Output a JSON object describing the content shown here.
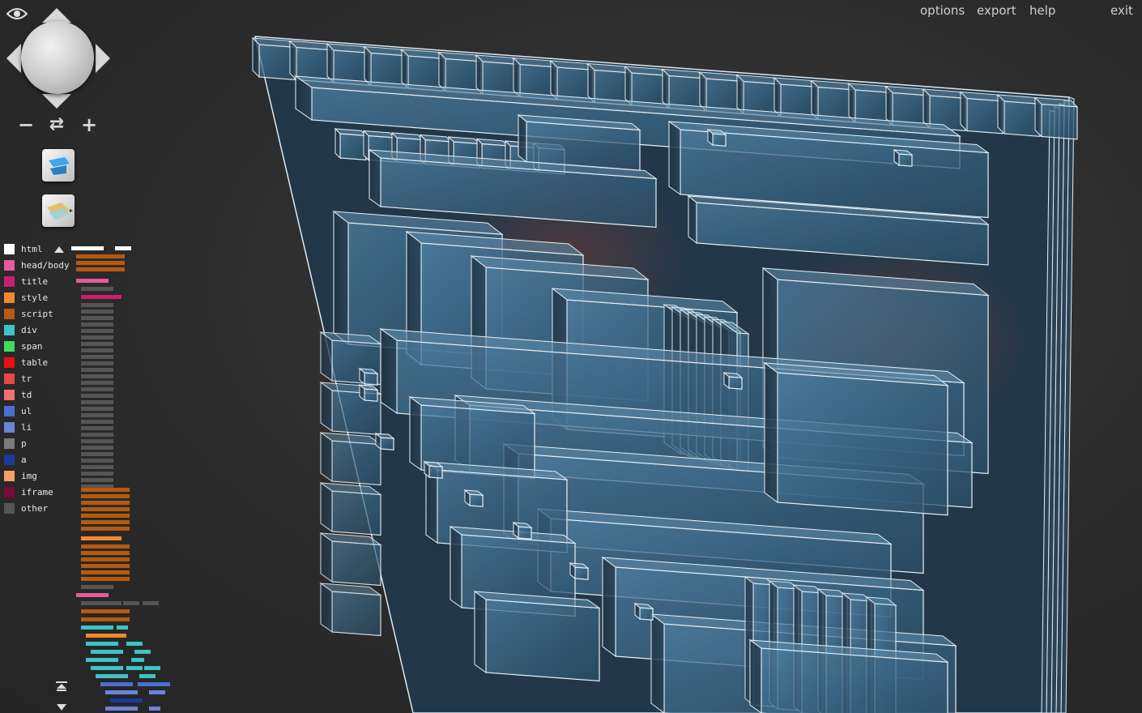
{
  "menu": {
    "options": "options",
    "export": "export",
    "help": "help",
    "exit": "exit"
  },
  "controls": {
    "zoom_out": "−",
    "reset": "⇄",
    "zoom_in": "+"
  },
  "legend": [
    {
      "label": "html",
      "color": "#ffffff"
    },
    {
      "label": "head/body",
      "color": "#e85a9b"
    },
    {
      "label": "title",
      "color": "#cc1f6e"
    },
    {
      "label": "style",
      "color": "#f08a2c"
    },
    {
      "label": "script",
      "color": "#b55a10"
    },
    {
      "label": "div",
      "color": "#3ec4c4"
    },
    {
      "label": "span",
      "color": "#3ddc5c"
    },
    {
      "label": "table",
      "color": "#e81010"
    },
    {
      "label": "tr",
      "color": "#e84848"
    },
    {
      "label": "td",
      "color": "#f07070"
    },
    {
      "label": "ul",
      "color": "#4a6fd0"
    },
    {
      "label": "li",
      "color": "#6a85d8"
    },
    {
      "label": "p",
      "color": "#7a7a7a"
    },
    {
      "label": "a",
      "color": "#1a3aa0"
    },
    {
      "label": "img",
      "color": "#f4a060"
    },
    {
      "label": "iframe",
      "color": "#7a0a3a"
    },
    {
      "label": "other",
      "color": "#555555"
    }
  ],
  "icons": {
    "visibility": "eye-icon",
    "scroll_up": "▲",
    "collapse_top": "⇞",
    "scroll_down": "▼"
  }
}
